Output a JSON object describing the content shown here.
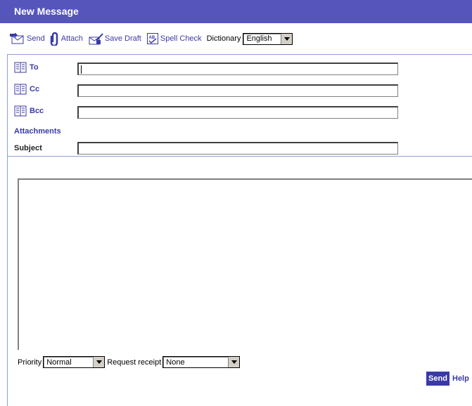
{
  "window": {
    "title": "New Message"
  },
  "toolbar": {
    "send_label": "Send",
    "attach_label": "Attach",
    "save_draft_label": "Save Draft",
    "spell_check_label": "Spell Check",
    "dictionary_label": "Dictionary",
    "dictionary_value": "English"
  },
  "fields": {
    "to_label": "To",
    "cc_label": "Cc",
    "bcc_label": "Bcc",
    "attachments_label": "Attachments",
    "subject_label": "Subject",
    "to_value": "",
    "cc_value": "",
    "bcc_value": "",
    "subject_value": ""
  },
  "options": {
    "priority_label": "Priority",
    "priority_value": "Normal",
    "receipt_label": "Request receipt",
    "receipt_value": "None"
  },
  "footer": {
    "send_label": "Send",
    "help_label": "Help"
  },
  "colors": {
    "accent": "#5555bb",
    "link": "#3a3aa6",
    "divider": "#8fa0d8"
  }
}
